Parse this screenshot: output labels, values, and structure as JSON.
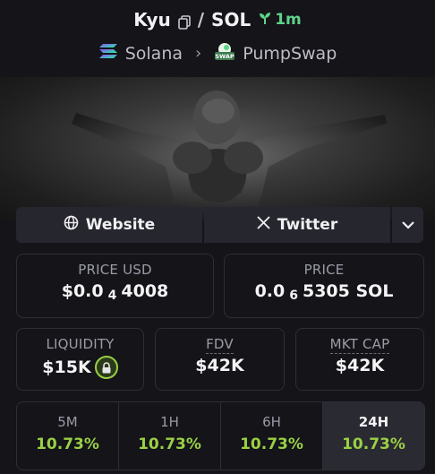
{
  "header": {
    "token_symbol": "Kyu",
    "separator": "/",
    "quote_symbol": "SOL",
    "age": "1m",
    "chain": "Solana",
    "dex": "PumpSwap",
    "dex_logo_text": "SWAP"
  },
  "links": {
    "website": "Website",
    "twitter": "Twitter"
  },
  "price_usd": {
    "label": "PRICE USD",
    "prefix": "$0.0",
    "zeros": "4",
    "digits": "4008"
  },
  "price_native": {
    "label": "PRICE",
    "prefix": "0.0",
    "zeros": "6",
    "digits": "5305 SOL"
  },
  "stats": {
    "liquidity": {
      "label": "LIQUIDITY",
      "value": "$15K"
    },
    "fdv": {
      "label": "FDV",
      "value": "$42K"
    },
    "mkt_cap": {
      "label": "MKT CAP",
      "value": "$42K"
    }
  },
  "timeframes": [
    {
      "label": "5M",
      "change": "10.73%"
    },
    {
      "label": "1H",
      "change": "10.73%"
    },
    {
      "label": "6H",
      "change": "10.73%"
    },
    {
      "label": "24H",
      "change": "10.73%"
    }
  ],
  "colors": {
    "background": "#141419",
    "positive": "#9ad045",
    "age": "#5fd38a"
  },
  "icons": [
    "copy-icon",
    "sprout-icon",
    "solana-icon",
    "pumpswap-icon",
    "globe-icon",
    "x-icon",
    "chevron-down-icon",
    "lock-icon"
  ]
}
